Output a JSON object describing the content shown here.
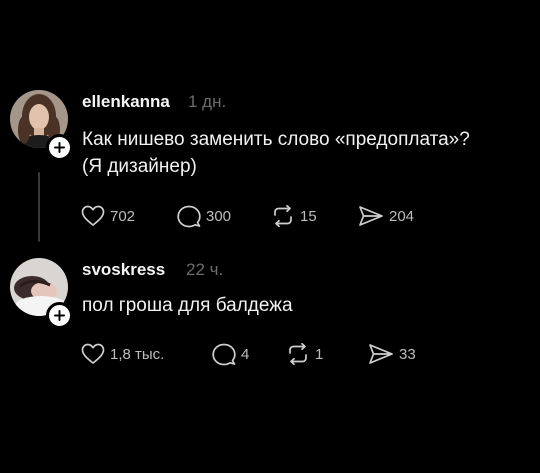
{
  "posts": [
    {
      "username": "ellenkanna",
      "time": "1 дн.",
      "text": "Как нишево заменить слово «предоплата»?\n(Я дизайнер)",
      "likes": "702",
      "replies": "300",
      "reposts": "15",
      "shares": "204"
    },
    {
      "username": "svoskress",
      "time": "22 ч.",
      "text": "пол гроша для балдежа",
      "likes": "1,8 тыс.",
      "replies": "4",
      "reposts": "1",
      "shares": "33"
    }
  ],
  "icons": {
    "like": "heart-icon",
    "reply": "comment-icon",
    "repost": "repost-icon",
    "share": "send-icon",
    "follow": "plus-icon"
  },
  "colors": {
    "background": "#000000",
    "text": "#f2f2f2",
    "muted": "#6c6c6c",
    "icon": "#cfcfcf"
  }
}
